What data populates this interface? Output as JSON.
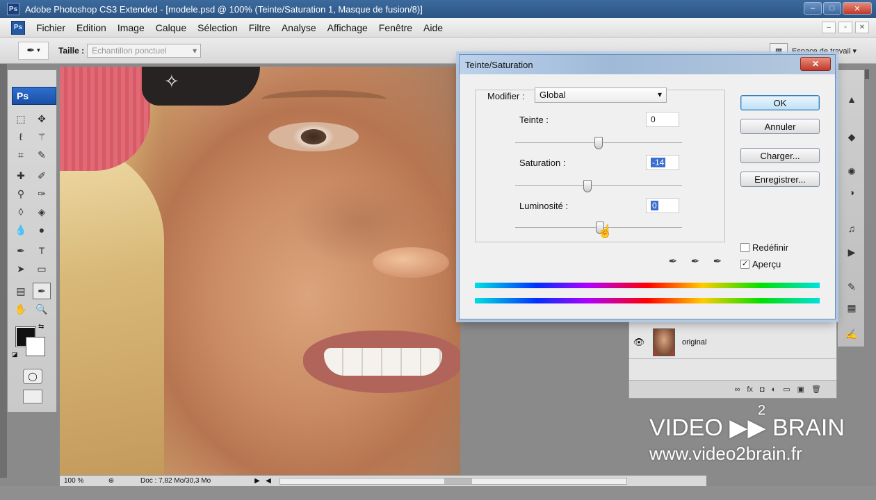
{
  "app": {
    "window_title": "Adobe Photoshop CS3 Extended - [modele.psd @ 100% (Teinte/Saturation 1, Masque de fusion/8)]",
    "ps_logo": "Ps"
  },
  "menu": {
    "items": [
      "Fichier",
      "Edition",
      "Image",
      "Calque",
      "Sélection",
      "Filtre",
      "Analyse",
      "Affichage",
      "Fenêtre",
      "Aide"
    ]
  },
  "options": {
    "size_label": "Taille :",
    "sample_value": "Echantillon ponctuel",
    "workspace_label": "Espace de travail ▾"
  },
  "dialog": {
    "title": "Teinte/Saturation",
    "modify_label": "Modifier :",
    "modify_value": "Global",
    "hue_label": "Teinte :",
    "hue_value": "0",
    "saturation_label": "Saturation :",
    "saturation_value": "-14",
    "lightness_label": "Luminosité :",
    "lightness_value": "0",
    "ok_label": "OK",
    "cancel_label": "Annuler",
    "load_label": "Charger...",
    "save_label": "Enregistrer...",
    "colorize_label": "Redéfinir",
    "colorize_checked": false,
    "preview_label": "Aperçu",
    "preview_checked": true,
    "close_glyph": "✕"
  },
  "layers": {
    "layer_name": "original"
  },
  "status": {
    "zoom": "100 %",
    "doc_info": "Doc : 7,82 Mo/30,3 Mo"
  },
  "watermark": {
    "brand": "VIDEO ▶▶ BRAIN",
    "superscript": "2",
    "site": "www.video2brain.fr"
  }
}
